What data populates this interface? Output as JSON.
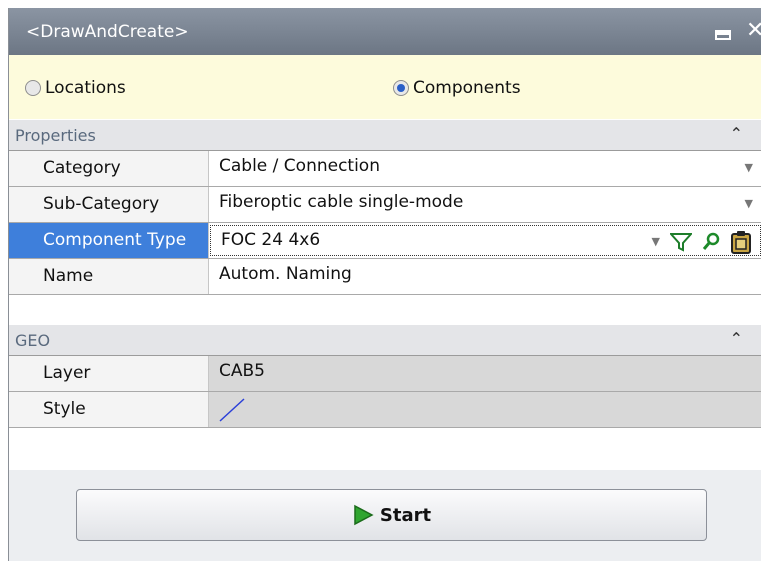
{
  "window": {
    "title": "<DrawAndCreate>"
  },
  "mode_options": [
    {
      "label": "Locations",
      "selected": false
    },
    {
      "label": "Components",
      "selected": true
    }
  ],
  "properties": {
    "header": "Properties",
    "rows": [
      {
        "label": "Category",
        "value": "Cable / Connection"
      },
      {
        "label": "Sub-Category",
        "value": "Fiberoptic cable single-mode"
      },
      {
        "label": "Component Type",
        "value": "FOC 24 4x6"
      },
      {
        "label": "Name",
        "value": "Autom. Naming"
      }
    ]
  },
  "geo": {
    "header": "GEO",
    "rows": [
      {
        "label": "Layer",
        "value": "CAB5"
      },
      {
        "label": "Style",
        "value": ""
      }
    ]
  },
  "actions": {
    "start_label": "Start"
  },
  "colors": {
    "title_bar": "#7b8593",
    "radio_bar": "#fdfbdc",
    "selection": "#3e7fdb",
    "start_icon": "#2fa52f",
    "style_line": "#2a3fd8"
  }
}
